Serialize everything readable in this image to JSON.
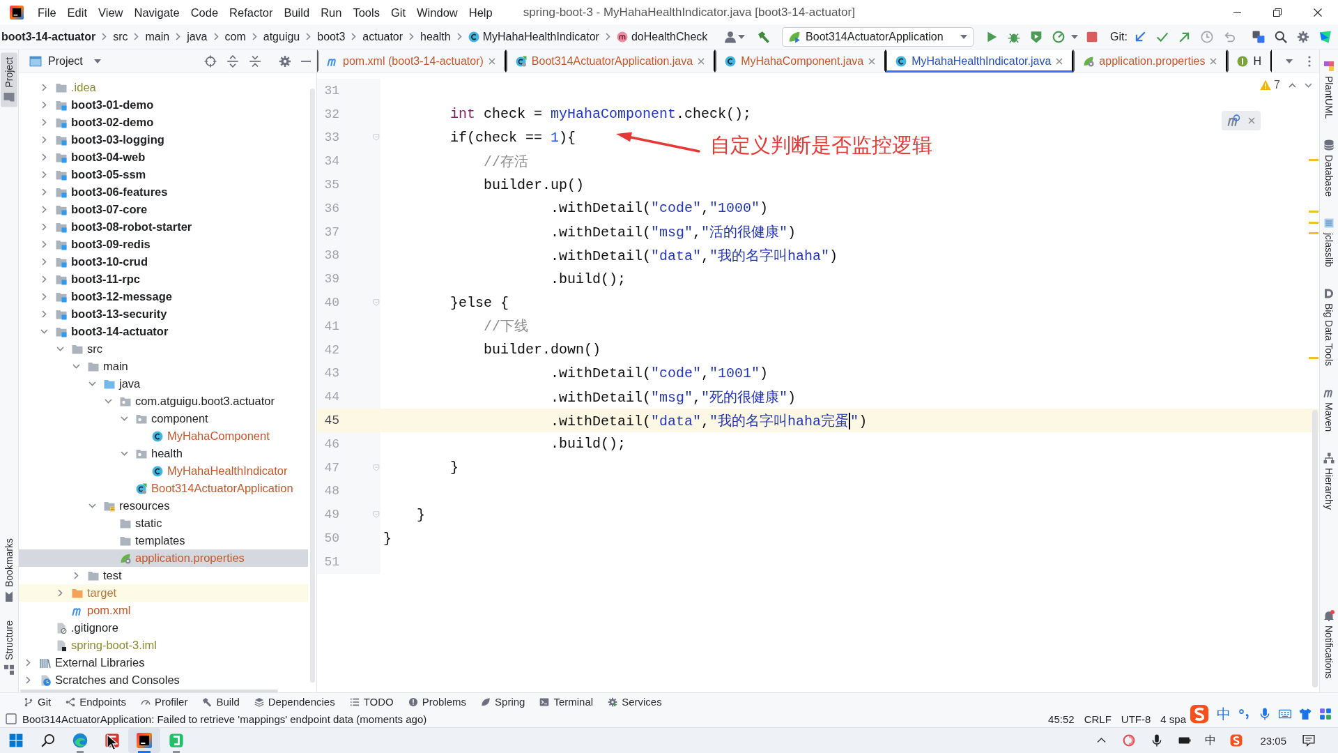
{
  "window": {
    "title": "spring-boot-3 - MyHahaHealthIndicator.java [boot3-14-actuator]"
  },
  "menu": [
    "File",
    "Edit",
    "View",
    "Navigate",
    "Code",
    "Refactor",
    "Build",
    "Run",
    "Tools",
    "Git",
    "Window",
    "Help"
  ],
  "breadcrumbs": [
    {
      "kind": "module",
      "label": "boot3-14-actuator"
    },
    {
      "kind": "folder",
      "label": "src"
    },
    {
      "kind": "folder",
      "label": "main"
    },
    {
      "kind": "folder",
      "label": "java"
    },
    {
      "kind": "folder",
      "label": "com"
    },
    {
      "kind": "folder",
      "label": "atguigu"
    },
    {
      "kind": "folder",
      "label": "boot3"
    },
    {
      "kind": "folder",
      "label": "actuator"
    },
    {
      "kind": "folder",
      "label": "health"
    },
    {
      "kind": "class",
      "label": "MyHahaHealthIndicator"
    },
    {
      "kind": "method",
      "label": "doHealthCheck"
    }
  ],
  "toolbar": {
    "run_configuration": "Boot314ActuatorApplication",
    "vcs_label": "Git:"
  },
  "left_stripe": [
    {
      "kind": "project",
      "label": "Project",
      "selected": true
    },
    {
      "kind": "bookmarks",
      "label": "Bookmarks",
      "selected": false
    },
    {
      "kind": "structure",
      "label": "Structure",
      "selected": false
    }
  ],
  "project_panel": {
    "title": "Project",
    "tree": [
      {
        "children": [
          {
            "kind": "folder",
            "label": ".idea",
            "expanded": false,
            "color": "#8a8a2e",
            "selected": false
          },
          {
            "kind": "module",
            "label": "boot3-01-demo",
            "expanded": false,
            "color": "#1e1f22",
            "selected": false
          },
          {
            "kind": "module",
            "label": "boot3-02-demo",
            "expanded": false,
            "color": "#1e1f22",
            "selected": false
          },
          {
            "kind": "module",
            "label": "boot3-03-logging",
            "expanded": false,
            "color": "#1e1f22",
            "selected": false
          },
          {
            "kind": "module",
            "label": "boot3-04-web",
            "expanded": false,
            "color": "#1e1f22",
            "selected": false
          },
          {
            "kind": "module",
            "label": "boot3-05-ssm",
            "expanded": false,
            "color": "#1e1f22",
            "selected": false
          },
          {
            "kind": "module",
            "label": "boot3-06-features",
            "expanded": false,
            "color": "#1e1f22",
            "selected": false
          },
          {
            "kind": "module",
            "label": "boot3-07-core",
            "expanded": false,
            "color": "#1e1f22",
            "selected": false
          },
          {
            "kind": "module",
            "label": "boot3-08-robot-starter",
            "expanded": false,
            "color": "#1e1f22",
            "selected": false
          },
          {
            "kind": "module",
            "label": "boot3-09-redis",
            "expanded": false,
            "color": "#1e1f22",
            "selected": false
          },
          {
            "kind": "module",
            "label": "boot3-10-crud",
            "expanded": false,
            "color": "#1e1f22",
            "selected": false
          },
          {
            "kind": "module",
            "label": "boot3-11-rpc",
            "expanded": false,
            "color": "#1e1f22",
            "selected": false
          },
          {
            "kind": "module",
            "label": "boot3-12-message",
            "expanded": false,
            "color": "#1e1f22",
            "selected": false
          },
          {
            "kind": "module",
            "label": "boot3-13-security",
            "expanded": false,
            "color": "#1e1f22",
            "selected": false
          },
          {
            "kind": "module",
            "label": "boot3-14-actuator",
            "expanded": true,
            "color": "#1e1f22",
            "selected": false,
            "children": [
              {
                "kind": "folder",
                "label": "src",
                "expanded": true,
                "color": "#1e1f22",
                "selected": false,
                "children": [
                  {
                    "kind": "folder",
                    "label": "main",
                    "expanded": true,
                    "color": "#1e1f22",
                    "selected": false,
                    "children": [
                      {
                        "kind": "source-root",
                        "label": "java",
                        "expanded": true,
                        "color": "#1e1f22",
                        "selected": false,
                        "children": [
                          {
                            "kind": "package",
                            "label": "com.atguigu.boot3.actuator",
                            "expanded": true,
                            "color": "#1e1f22",
                            "selected": false,
                            "children": [
                              {
                                "kind": "package",
                                "label": "component",
                                "expanded": true,
                                "color": "#1e1f22",
                                "selected": false,
                                "children": [
                                  {
                                    "kind": "class",
                                    "label": "MyHahaComponent",
                                    "color": "#c4572a",
                                    "selected": false
                                  }
                                ]
                              },
                              {
                                "kind": "package",
                                "label": "health",
                                "expanded": true,
                                "color": "#1e1f22",
                                "selected": false,
                                "children": [
                                  {
                                    "kind": "class",
                                    "label": "MyHahaHealthIndicator",
                                    "color": "#c4572a",
                                    "selected": false
                                  }
                                ]
                              },
                              {
                                "kind": "spring-class",
                                "label": "Boot314ActuatorApplication",
                                "color": "#c4572a",
                                "selected": false
                              }
                            ]
                          }
                        ]
                      },
                      {
                        "kind": "resources-root",
                        "label": "resources",
                        "expanded": true,
                        "color": "#1e1f22",
                        "selected": false,
                        "children": [
                          {
                            "kind": "folder",
                            "label": "static",
                            "color": "#1e1f22",
                            "selected": false
                          },
                          {
                            "kind": "folder",
                            "label": "templates",
                            "color": "#1e1f22",
                            "selected": false
                          },
                          {
                            "kind": "properties",
                            "label": "application.properties",
                            "color": "#c4572a",
                            "selected": true
                          }
                        ]
                      }
                    ]
                  },
                  {
                    "kind": "folder",
                    "label": "test",
                    "expanded": false,
                    "color": "#1e1f22",
                    "selected": false
                  }
                ]
              },
              {
                "kind": "excluded-folder",
                "label": "target",
                "expanded": false,
                "color": "#b8763a",
                "selected": false
              },
              {
                "kind": "maven",
                "label": "pom.xml",
                "color": "#c4572a",
                "selected": false
              }
            ]
          },
          {
            "kind": "gitignore",
            "label": ".gitignore",
            "color": "#1e1f22",
            "selected": false
          },
          {
            "kind": "iml",
            "label": "spring-boot-3.iml",
            "color": "#8a8a2e",
            "selected": false
          }
        ]
      },
      {
        "kind": "libraries",
        "label": "External Libraries",
        "expanded": false,
        "color": "#1e1f22",
        "selected": false
      },
      {
        "kind": "scratches",
        "label": "Scratches and Consoles",
        "expanded": false,
        "color": "#1e1f22",
        "selected": false
      }
    ]
  },
  "editor_tabs": [
    {
      "kind": "maven",
      "label": "pom.xml (boot3-14-actuator)",
      "color": "#c4572a",
      "selected": false
    },
    {
      "kind": "spring-class",
      "label": "Boot314ActuatorApplication.java",
      "color": "#c4572a",
      "selected": false
    },
    {
      "kind": "class",
      "label": "MyHahaComponent.java",
      "color": "#c4572a",
      "selected": false
    },
    {
      "kind": "class",
      "label": "MyHahaHealthIndicator.java",
      "color": "#2350b8",
      "selected": true
    },
    {
      "kind": "properties",
      "label": "application.properties",
      "color": "#c4572a",
      "selected": false
    },
    {
      "kind": "info",
      "label": "H",
      "color": "#1e1f22",
      "selected": false
    }
  ],
  "editor": {
    "warning_count": "7",
    "annotation": "自定义判断是否监控逻辑",
    "lines": [
      {
        "number": "31",
        "current": false,
        "fold": false
      },
      {
        "number": "32",
        "current": false,
        "fold": false,
        "segments": [
          {
            "kind": "keyword",
            "text": "        int"
          },
          {
            "kind": "plain",
            "text": " check = "
          },
          {
            "kind": "field",
            "text": "myHahaComponent"
          },
          {
            "kind": "plain",
            "text": ".check();"
          }
        ]
      },
      {
        "number": "33",
        "current": false,
        "fold": true,
        "segments": [
          {
            "kind": "plain",
            "text": "        if(check == "
          },
          {
            "kind": "number",
            "text": "1"
          },
          {
            "kind": "plain",
            "text": "){"
          }
        ]
      },
      {
        "number": "34",
        "current": false,
        "fold": false,
        "segments": [
          {
            "kind": "comment",
            "text": "            //存活"
          }
        ]
      },
      {
        "number": "35",
        "current": false,
        "fold": false,
        "segments": [
          {
            "kind": "plain",
            "text": "            builder.up()"
          }
        ]
      },
      {
        "number": "36",
        "current": false,
        "fold": false,
        "segments": [
          {
            "kind": "plain",
            "text": "                    .withDetail("
          },
          {
            "kind": "string",
            "text": "\"code\""
          },
          {
            "kind": "plain",
            "text": ","
          },
          {
            "kind": "string",
            "text": "\"1000\""
          },
          {
            "kind": "plain",
            "text": ")"
          }
        ]
      },
      {
        "number": "37",
        "current": false,
        "fold": false,
        "segments": [
          {
            "kind": "plain",
            "text": "                    .withDetail("
          },
          {
            "kind": "string",
            "text": "\"msg\""
          },
          {
            "kind": "plain",
            "text": ","
          },
          {
            "kind": "string",
            "text": "\"活的很健康\""
          },
          {
            "kind": "plain",
            "text": ")"
          }
        ]
      },
      {
        "number": "38",
        "current": false,
        "fold": false,
        "segments": [
          {
            "kind": "plain",
            "text": "                    .withDetail("
          },
          {
            "kind": "string",
            "text": "\"data\""
          },
          {
            "kind": "plain",
            "text": ","
          },
          {
            "kind": "string",
            "text": "\"我的名字叫haha\""
          },
          {
            "kind": "plain",
            "text": ")"
          }
        ]
      },
      {
        "number": "39",
        "current": false,
        "fold": false,
        "segments": [
          {
            "kind": "plain",
            "text": "                    .build();"
          }
        ]
      },
      {
        "number": "40",
        "current": false,
        "fold": true,
        "segments": [
          {
            "kind": "plain",
            "text": "        }else {"
          }
        ]
      },
      {
        "number": "41",
        "current": false,
        "fold": false,
        "segments": [
          {
            "kind": "comment",
            "text": "            //下线"
          }
        ]
      },
      {
        "number": "42",
        "current": false,
        "fold": false,
        "segments": [
          {
            "kind": "plain",
            "text": "            builder.down()"
          }
        ]
      },
      {
        "number": "43",
        "current": false,
        "fold": false,
        "segments": [
          {
            "kind": "plain",
            "text": "                    .withDetail("
          },
          {
            "kind": "string",
            "text": "\"code\""
          },
          {
            "kind": "plain",
            "text": ","
          },
          {
            "kind": "string",
            "text": "\"1001\""
          },
          {
            "kind": "plain",
            "text": ")"
          }
        ]
      },
      {
        "number": "44",
        "current": false,
        "fold": false,
        "segments": [
          {
            "kind": "plain",
            "text": "                    .withDetail("
          },
          {
            "kind": "string",
            "text": "\"msg\""
          },
          {
            "kind": "plain",
            "text": ","
          },
          {
            "kind": "string",
            "text": "\"死的很健康\""
          },
          {
            "kind": "plain",
            "text": ")"
          }
        ]
      },
      {
        "number": "45",
        "current": true,
        "fold": false,
        "segments": [
          {
            "kind": "plain",
            "text": "                    .withDetail("
          },
          {
            "kind": "string",
            "text": "\"data\""
          },
          {
            "kind": "plain",
            "text": ","
          },
          {
            "kind": "string",
            "text": "\"我的名字叫haha完蛋"
          },
          {
            "kind": "caret"
          },
          {
            "kind": "string",
            "text": "\""
          },
          {
            "kind": "plain",
            "text": ")"
          }
        ]
      },
      {
        "number": "46",
        "current": false,
        "fold": false,
        "segments": [
          {
            "kind": "plain",
            "text": "                    .build();"
          }
        ]
      },
      {
        "number": "47",
        "current": false,
        "fold": true,
        "segments": [
          {
            "kind": "plain",
            "text": "        }"
          }
        ]
      },
      {
        "number": "48",
        "current": false,
        "fold": false
      },
      {
        "number": "49",
        "current": false,
        "fold": true,
        "segments": [
          {
            "kind": "plain",
            "text": "    }"
          }
        ]
      },
      {
        "number": "50",
        "current": false,
        "fold": false,
        "segments": [
          {
            "kind": "plain",
            "text": "}"
          }
        ]
      },
      {
        "number": "51",
        "current": false,
        "fold": false
      }
    ]
  },
  "right_stripe": [
    {
      "kind": "plantuml",
      "label": "PlantUML",
      "unread": false
    },
    {
      "kind": "database",
      "label": "Database",
      "unread": false
    },
    {
      "kind": "jclasslib",
      "label": "jclasslib",
      "unread": false
    },
    {
      "kind": "bigdata",
      "label": "Big Data Tools",
      "unread": false
    },
    {
      "kind": "maven",
      "label": "Maven",
      "unread": false
    },
    {
      "kind": "hierarchy",
      "label": "Hierarchy",
      "unread": false
    },
    {
      "kind": "notifications",
      "label": "Notifications",
      "unread": true
    }
  ],
  "tool_windows": [
    {
      "kind": "git",
      "label": "Git"
    },
    {
      "kind": "endpoints",
      "label": "Endpoints"
    },
    {
      "kind": "profiler",
      "label": "Profiler"
    },
    {
      "kind": "build",
      "label": "Build"
    },
    {
      "kind": "dependencies",
      "label": "Dependencies"
    },
    {
      "kind": "todo",
      "label": "TODO"
    },
    {
      "kind": "problems",
      "label": "Problems"
    },
    {
      "kind": "spring",
      "label": "Spring"
    },
    {
      "kind": "terminal",
      "label": "Terminal"
    },
    {
      "kind": "services",
      "label": "Services"
    }
  ],
  "status_bar": {
    "message": "Boot314ActuatorApplication: Failed to retrieve 'mappings' endpoint data (moments ago)",
    "position": "45:52",
    "line_separator": "CRLF",
    "encoding": "UTF-8",
    "indent": "4 spa"
  },
  "ime_toolbar": {
    "mode": "中"
  },
  "taskbar": {
    "apps": [
      {
        "kind": "edge",
        "running": true,
        "selected": false
      },
      {
        "kind": "red-app",
        "running": false,
        "selected": false
      },
      {
        "kind": "intellij",
        "running": true,
        "selected": true
      },
      {
        "kind": "green-app",
        "running": true,
        "selected": false
      }
    ],
    "input_indicator": "中",
    "clock": "23:05"
  }
}
